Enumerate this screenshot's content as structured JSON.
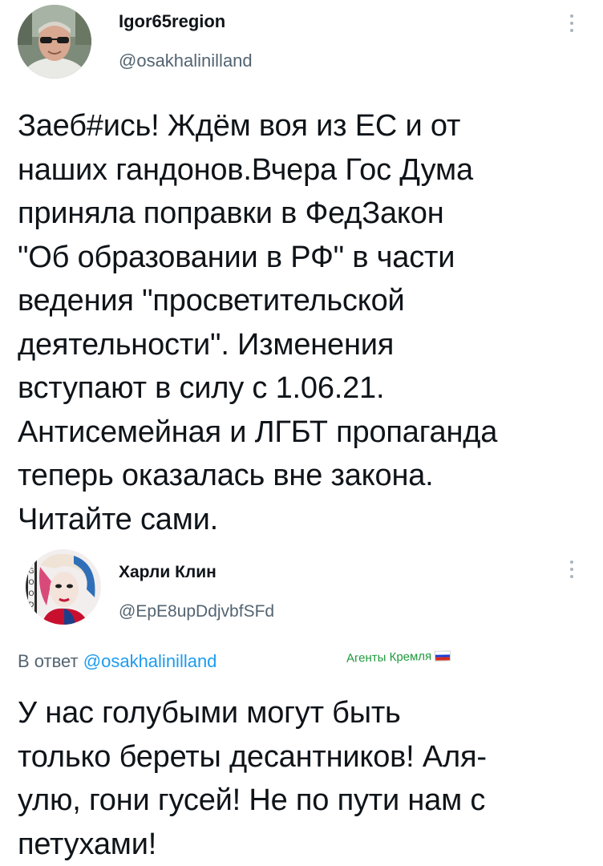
{
  "tweet1": {
    "display_name": "Igor65region",
    "handle": "@osakhalinilland",
    "text_lines": [
      "Заеб#ись! Ждём воя из ЕС и от",
      "наших гандонов.Вчера Гос Дума",
      "приняла поправки в ФедЗакон",
      "\"Об образовании в РФ\" в части",
      "ведения \"просветительской",
      "деятельности\". Изменения",
      "вступают в силу с 1.06.21.",
      "Антисемейная и ЛГБТ пропаганда",
      "теперь оказалась вне закона.",
      "Читайте сами."
    ]
  },
  "tweet2": {
    "display_name": "Харли Клин",
    "handle": "@EpE8upDdjvbfSFd",
    "reply_prefix": "В ответ",
    "reply_mention": "@osakhalinilland",
    "text_lines": [
      "У нас голубыми могут быть",
      "только береты десантников! Аля-",
      "улю, гони гусей! Не по пути нам с",
      "петухами!"
    ]
  },
  "watermark": {
    "text": "Агенты Кремля",
    "color": "#1f9a3c",
    "flag_colors": [
      "#ffffff",
      "#1c3fd6",
      "#d52b1e"
    ]
  },
  "colors": {
    "text": "#0f1419",
    "secondary": "#536471",
    "link": "#1d9bf0"
  },
  "icons": {
    "more": "more-vertical-icon",
    "avatar1": "user-avatar-photo",
    "avatar2": "user-avatar-photo"
  }
}
